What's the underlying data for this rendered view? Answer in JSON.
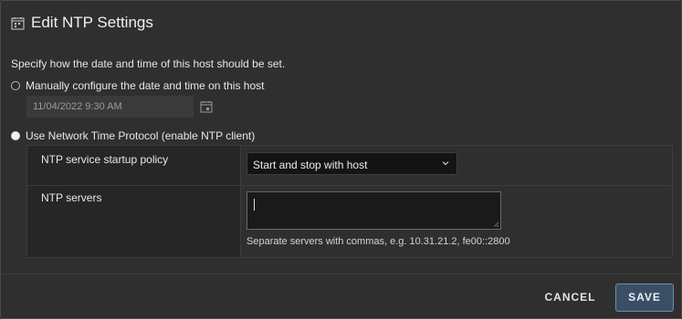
{
  "dialog": {
    "title": "Edit NTP Settings",
    "title_icon": "calendar-clock-icon",
    "description": "Specify how the date and time of this host should be set."
  },
  "manual": {
    "label": "Manually configure the date and time on this host",
    "selected": false,
    "datetime_value": "11/04/2022 9:30 AM",
    "calendar_icon": "calendar-icon"
  },
  "ntp": {
    "label": "Use Network Time Protocol (enable NTP client)",
    "selected": true,
    "startup_policy_label": "NTP service startup policy",
    "startup_policy_value": "Start and stop with host",
    "servers_label": "NTP servers",
    "servers_value": "",
    "servers_hint": "Separate servers with commas, e.g. 10.31.21.2, fe00::2800"
  },
  "footer": {
    "cancel_label": "CANCEL",
    "save_label": "SAVE"
  },
  "colors": {
    "background": "#2f2f2f",
    "label_cell": "#262626",
    "save_button": "#3a4f66",
    "save_border": "#6a8db0"
  }
}
